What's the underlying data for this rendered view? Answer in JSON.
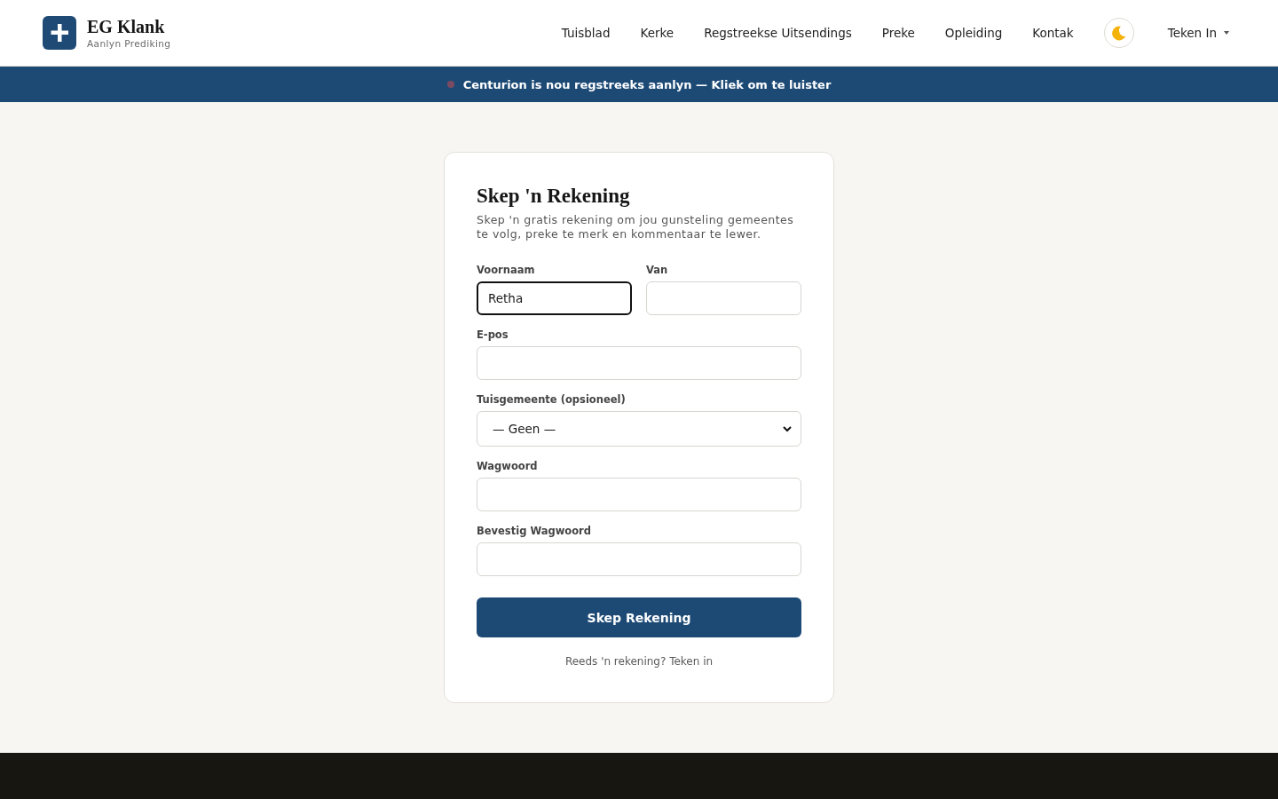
{
  "header": {
    "brand": {
      "name": "EG Klank",
      "tagline": "Aanlyn Prediking"
    },
    "nav": [
      "Tuisblad",
      "Kerke",
      "Regstreekse Uitsendings",
      "Preke",
      "Opleiding",
      "Kontak"
    ],
    "account_menu": {
      "label": "Teken In"
    }
  },
  "banner": {
    "text": "Centurion is nou regstreeks aanlyn — Kliek om te luister"
  },
  "form": {
    "title": "Skep 'n Rekening",
    "subtitle": "Skep 'n gratis rekening om jou gunsteling gemeentes te volg, preke te merk en kommentaar te lewer.",
    "rows": [
      {
        "fields": [
          {
            "kind": "input",
            "label": "Voornaam",
            "value": "Retha",
            "focused": true
          },
          {
            "kind": "input",
            "label": "Van",
            "focused": false
          }
        ]
      },
      {
        "fields": [
          {
            "kind": "input",
            "label": "E-pos",
            "focused": false
          }
        ]
      },
      {
        "fields": [
          {
            "kind": "select",
            "label": "Tuisgemeente (opsioneel)",
            "value": "— Geen —",
            "focused": false
          }
        ]
      },
      {
        "fields": [
          {
            "kind": "input",
            "label": "Wagwoord",
            "focused": false
          }
        ]
      },
      {
        "fields": [
          {
            "kind": "input",
            "label": "Bevestig Wagwoord",
            "focused": false
          }
        ]
      }
    ],
    "submit": "Skep Rekening",
    "signin_prompt": {
      "text": "Reeds 'n rekening?",
      "link": "Teken in"
    }
  }
}
